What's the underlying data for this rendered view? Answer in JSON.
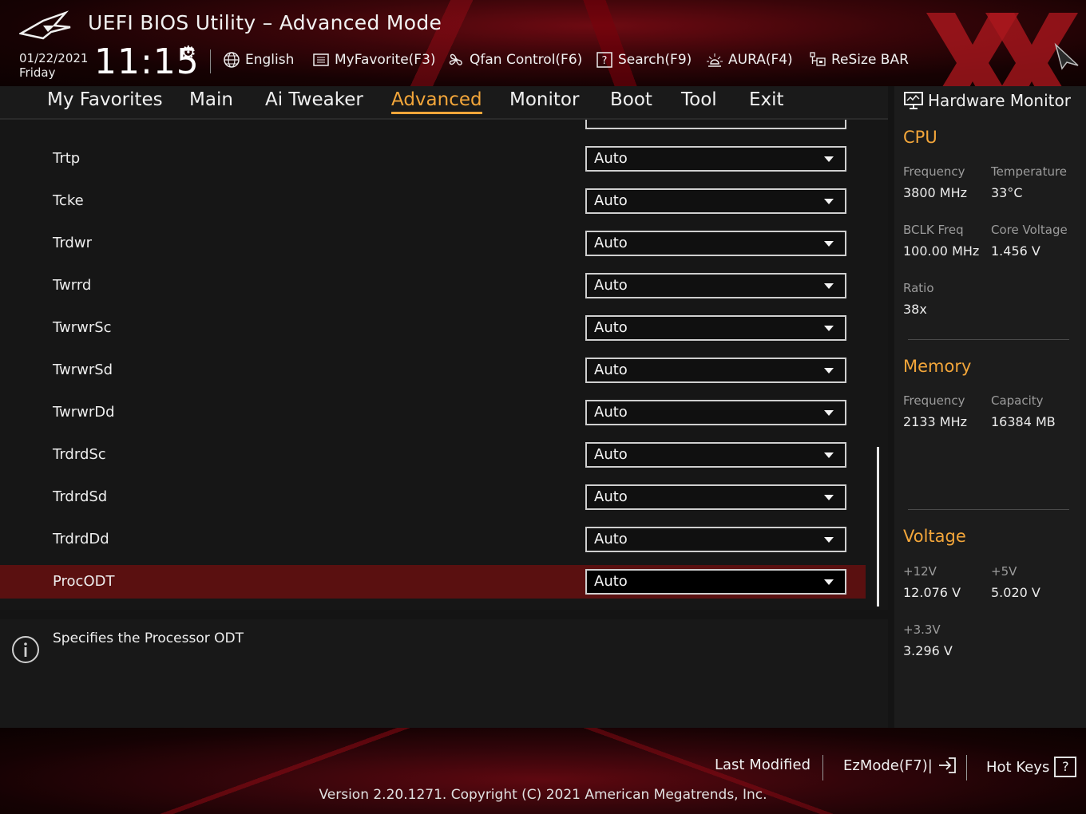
{
  "header": {
    "title": "UEFI BIOS Utility – Advanced Mode",
    "date": "01/22/2021",
    "day": "Friday",
    "time": "11:15",
    "tools": [
      {
        "label": "English",
        "icon": "globe-icon"
      },
      {
        "label": "MyFavorite(F3)",
        "icon": "favorite-list-icon"
      },
      {
        "label": "Qfan Control(F6)",
        "icon": "fan-icon"
      },
      {
        "label": "Search(F9)",
        "icon": "search-question-icon"
      },
      {
        "label": "AURA(F4)",
        "icon": "aura-light-icon"
      },
      {
        "label": "ReSize BAR",
        "icon": "resize-bar-icon"
      }
    ]
  },
  "menu": {
    "tabs": [
      {
        "label": "My Favorites",
        "active": false
      },
      {
        "label": "Main",
        "active": false
      },
      {
        "label": "Ai Tweaker",
        "active": false
      },
      {
        "label": "Advanced",
        "active": true
      },
      {
        "label": "Monitor",
        "active": false
      },
      {
        "label": "Boot",
        "active": false
      },
      {
        "label": "Tool",
        "active": false
      },
      {
        "label": "Exit",
        "active": false
      }
    ]
  },
  "settings": [
    {
      "label": "Trtp",
      "value": "Auto"
    },
    {
      "label": "Tcke",
      "value": "Auto"
    },
    {
      "label": "Trdwr",
      "value": "Auto"
    },
    {
      "label": "Twrrd",
      "value": "Auto"
    },
    {
      "label": "TwrwrSc",
      "value": "Auto"
    },
    {
      "label": "TwrwrSd",
      "value": "Auto"
    },
    {
      "label": "TwrwrDd",
      "value": "Auto"
    },
    {
      "label": "TrdrdSc",
      "value": "Auto"
    },
    {
      "label": "TrdrdSd",
      "value": "Auto"
    },
    {
      "label": "TrdrdDd",
      "value": "Auto"
    },
    {
      "label": "ProcODT",
      "value": "Auto",
      "selected": true
    }
  ],
  "description": "Specifies the Processor ODT",
  "hardware_monitor": {
    "title": "Hardware Monitor",
    "cpu": {
      "heading": "CPU",
      "frequency_label": "Frequency",
      "frequency": "3800 MHz",
      "temperature_label": "Temperature",
      "temperature": "33°C",
      "bclk_label": "BCLK Freq",
      "bclk": "100.00 MHz",
      "core_voltage_label": "Core Voltage",
      "core_voltage": "1.456 V",
      "ratio_label": "Ratio",
      "ratio": "38x"
    },
    "memory": {
      "heading": "Memory",
      "frequency_label": "Frequency",
      "frequency": "2133 MHz",
      "capacity_label": "Capacity",
      "capacity": "16384 MB"
    },
    "voltage": {
      "heading": "Voltage",
      "v12_label": "+12V",
      "v12": "12.076 V",
      "v5_label": "+5V",
      "v5": "5.020 V",
      "v33_label": "+3.3V",
      "v33": "3.296 V"
    }
  },
  "footer": {
    "last_modified": "Last Modified",
    "ezmode": "EzMode(F7)|",
    "hotkeys": "Hot Keys",
    "hotkeys_glyph": "?",
    "version": "Version 2.20.1271. Copyright (C) 2021 American Megatrends, Inc."
  },
  "colors": {
    "accent": "#f3a63a",
    "selected_row": "#5a1010"
  }
}
